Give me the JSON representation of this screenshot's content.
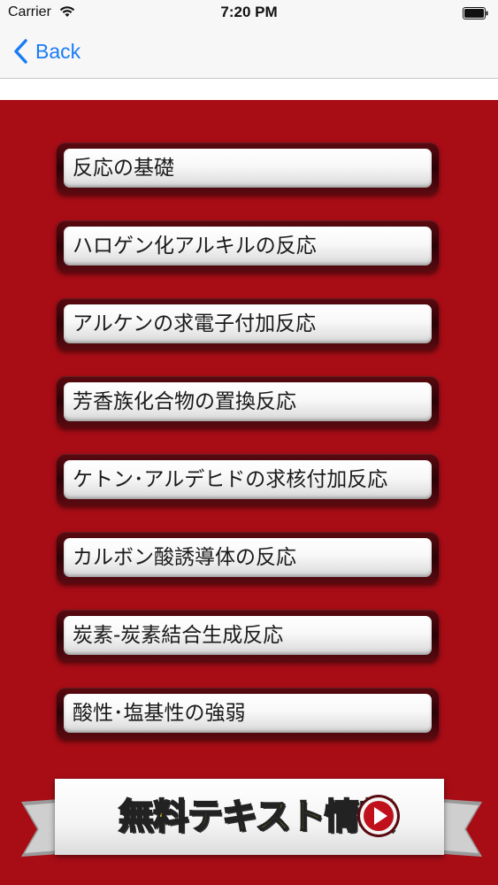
{
  "status_bar": {
    "carrier": "Carrier",
    "time": "7:20 PM"
  },
  "nav_bar": {
    "back_label": "Back"
  },
  "menu": {
    "items": [
      {
        "label": "反応の基礎"
      },
      {
        "label": "ハロゲン化アルキルの反応"
      },
      {
        "label": "アルケンの求電子付加反応"
      },
      {
        "label": "芳香族化合物の置換反応"
      },
      {
        "label": "ケトン･アルデヒドの求核付加反応"
      },
      {
        "label": "カルボン酸誘導体の反応"
      },
      {
        "label": "炭素-炭素結合生成反応"
      },
      {
        "label": "酸性･塩基性の強弱"
      }
    ]
  },
  "banner": {
    "title": "無料テキスト情報"
  },
  "colors": {
    "background": "#a80d16",
    "ios_blue": "#1a7cf5",
    "banner_text": "#ffe81a",
    "play_circle": "#c0101c"
  },
  "icons": {
    "wifi": "wifi-icon",
    "battery": "battery-icon",
    "back": "back-chevron-icon",
    "play": "play-icon"
  }
}
